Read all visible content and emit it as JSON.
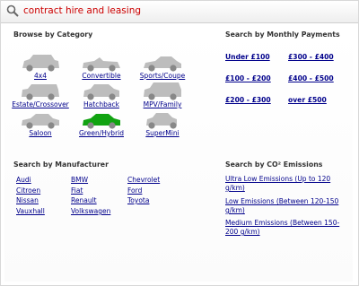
{
  "search": {
    "value": "contract hire and leasing"
  },
  "category": {
    "heading": "Browse by Category",
    "items": [
      {
        "label": "4x4",
        "icon": "car-4x4-icon",
        "color": "#bdbdbd"
      },
      {
        "label": "Convertible",
        "icon": "car-convertible-icon",
        "color": "#bdbdbd"
      },
      {
        "label": "Sports/Coupe",
        "icon": "car-sports-coupe-icon",
        "color": "#bdbdbd"
      },
      {
        "label": "Estate/Crossover",
        "icon": "car-estate-icon",
        "color": "#bdbdbd"
      },
      {
        "label": "Hatchback",
        "icon": "car-hatchback-icon",
        "color": "#bdbdbd"
      },
      {
        "label": "MPV/Family",
        "icon": "car-mpv-icon",
        "color": "#bdbdbd"
      },
      {
        "label": "Saloon",
        "icon": "car-saloon-icon",
        "color": "#bdbdbd"
      },
      {
        "label": "Green/Hybrid",
        "icon": "car-green-hybrid-icon",
        "color": "#11a311"
      },
      {
        "label": "SuperMini",
        "icon": "car-supermini-icon",
        "color": "#bdbdbd"
      }
    ]
  },
  "payments": {
    "heading": "Search by Monthly Payments",
    "items": [
      "Under £100",
      "£300 - £400",
      "£100 - £200",
      "£400 - £500",
      "£200 - £300",
      "over £500"
    ]
  },
  "manufacturer": {
    "heading": "Search by Manufacturer",
    "items": [
      "Audi",
      "BMW",
      "Chevrolet",
      "Citroen",
      "Fiat",
      "Ford",
      "Nissan",
      "Renault",
      "Toyota",
      "Vauxhall",
      "Volkswagen"
    ]
  },
  "co2": {
    "heading": "Search by CO² Emissions",
    "items": [
      "Ultra Low Emissions (Up to 120 g/km)",
      "Low Emissions (Between 120-150 g/km)",
      "Medium Emissions (Between 150-200 g/km)"
    ]
  }
}
